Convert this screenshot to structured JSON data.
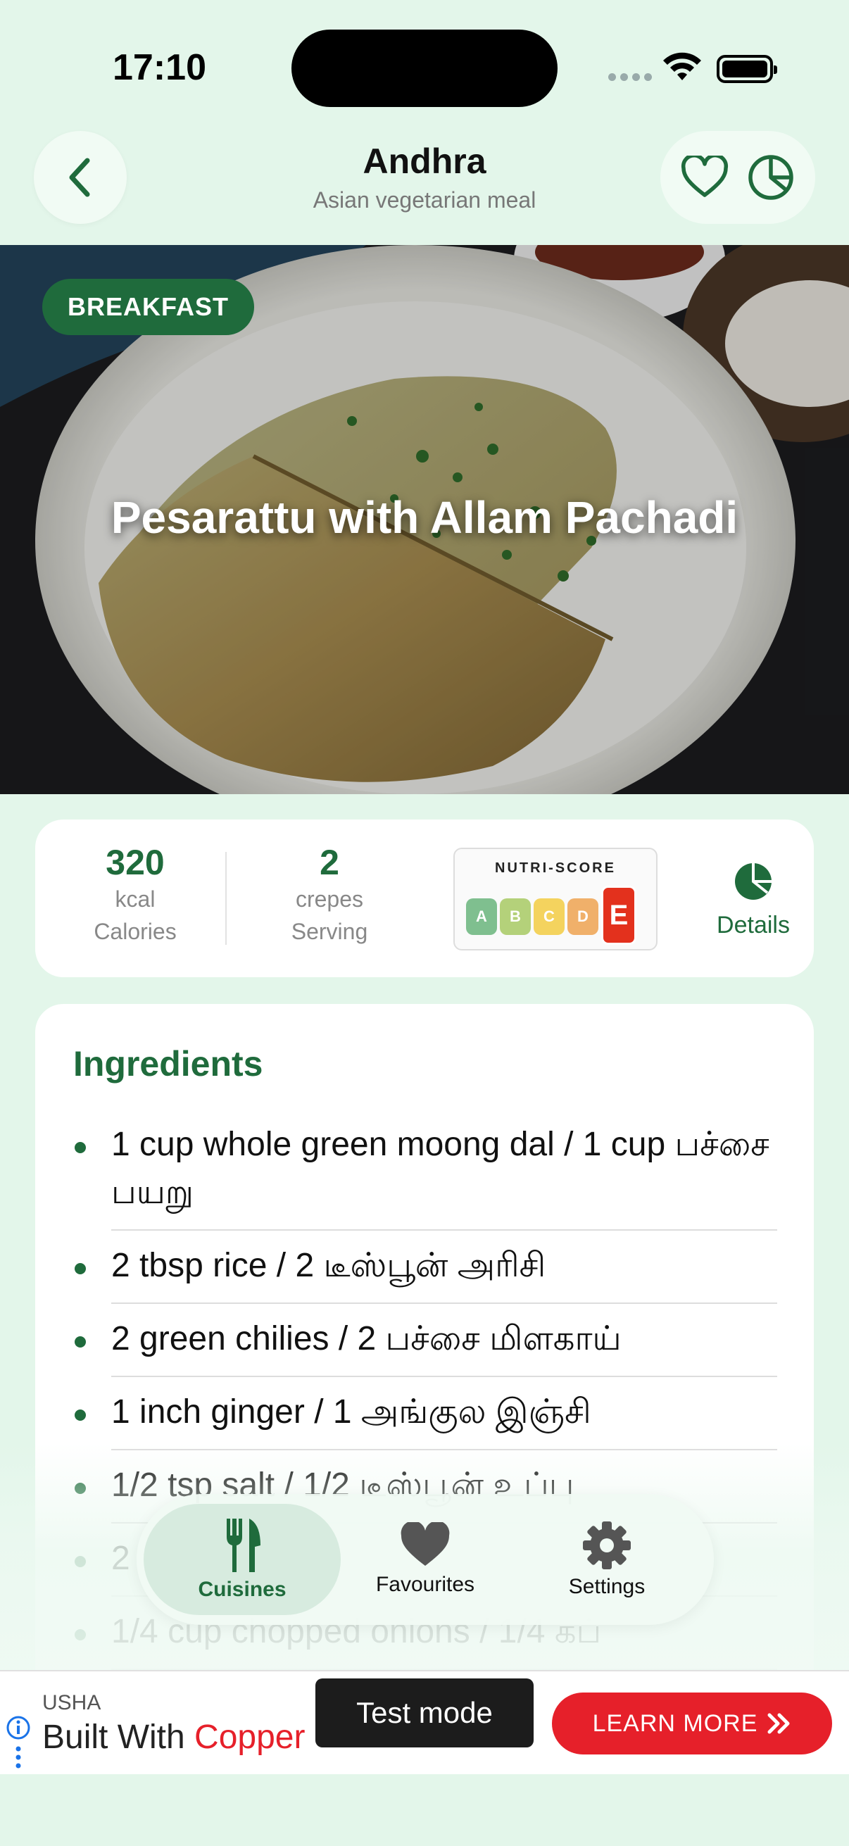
{
  "status_bar": {
    "time": "17:10"
  },
  "header": {
    "title": "Andhra",
    "subtitle": "Asian vegetarian meal",
    "back_icon": "chevron-left-icon",
    "favourite_icon": "heart-outline-icon",
    "nutrition_icon": "pie-chart-icon"
  },
  "hero": {
    "badge": "BREAKFAST",
    "title": "Pesarattu with Allam Pachadi"
  },
  "stats": {
    "calories_value": "320",
    "calories_unit": "kcal",
    "calories_label": "Calories",
    "serving_value": "2",
    "serving_unit": "crepes",
    "serving_label": "Serving",
    "nutri_score": {
      "title": "NUTRI-SCORE",
      "grades": [
        "A",
        "B",
        "C",
        "D",
        "E"
      ],
      "selected": "E",
      "colors": [
        "#7fbf8f",
        "#b4d17a",
        "#f4d35e",
        "#f0b06a",
        "#e3311d"
      ]
    },
    "details_label": "Details"
  },
  "ingredients": {
    "title": "Ingredients",
    "items": [
      "1 cup whole green moong dal / 1 cup பச்சை பயறு",
      "2 tbsp rice / 2 டீஸ்பூன் அரிசி",
      "2 green chilies / 2 பச்சை மிளகாய்",
      "1 inch ginger / 1 அங்குல இஞ்சி",
      "1/2 tsp salt / 1/2 டீஸ்பூன் உப்பு",
      "2",
      "1/4 cup chopped onions / 1/4 கப்"
    ]
  },
  "tabbar": {
    "tabs": [
      {
        "label": "Cuisines",
        "icon": "fork-knife-icon",
        "active": true
      },
      {
        "label": "Favourites",
        "icon": "heart-icon",
        "active": false
      },
      {
        "label": "Settings",
        "icon": "gear-icon",
        "active": false
      }
    ]
  },
  "ad": {
    "brand": "USHA",
    "headline_prefix": "Built With ",
    "headline_highlight": "Copper",
    "cta": "LEARN MORE",
    "toast": "Test mode"
  },
  "colors": {
    "accent": "#1f6b3c",
    "background": "#e3f6ea",
    "ad_red": "#e6202a"
  }
}
